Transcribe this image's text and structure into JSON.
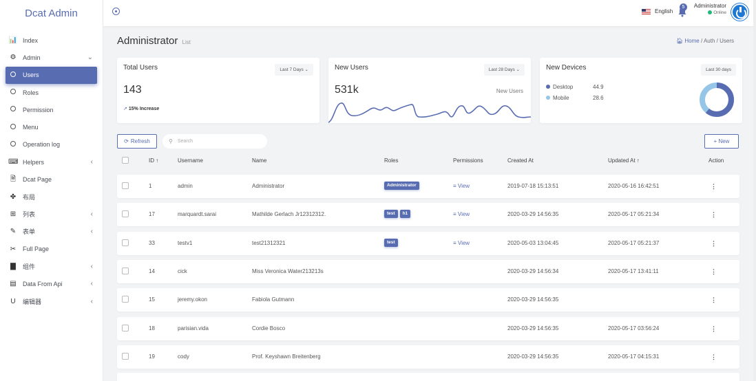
{
  "sidebar": {
    "brand": "Dcat Admin",
    "items": [
      {
        "label": "Index",
        "icon": "bar-chart-icon",
        "glyph": "📊"
      },
      {
        "label": "Admin",
        "icon": "gear-icon",
        "glyph": "⚙",
        "arrow": "⌄"
      },
      {
        "label": "Users",
        "icon": "circle-icon",
        "active": true
      },
      {
        "label": "Roles",
        "icon": "circle-icon"
      },
      {
        "label": "Permission",
        "icon": "circle-icon"
      },
      {
        "label": "Menu",
        "icon": "circle-icon"
      },
      {
        "label": "Operation log",
        "icon": "circle-icon"
      },
      {
        "label": "Helpers",
        "icon": "keyboard-icon",
        "glyph": "⌨",
        "arrow": "‹"
      },
      {
        "label": "Dcat Page",
        "icon": "document-icon",
        "glyph": "🗎"
      },
      {
        "label": "布局",
        "icon": "layout-icon",
        "glyph": "✤"
      },
      {
        "label": "列表",
        "icon": "grid-icon",
        "glyph": "⊞",
        "arrow": "‹"
      },
      {
        "label": "表单",
        "icon": "edit-icon",
        "glyph": "✎",
        "arrow": "‹"
      },
      {
        "label": "Full Page",
        "icon": "scissors-icon",
        "glyph": "✂"
      },
      {
        "label": "组件",
        "icon": "book-icon",
        "glyph": "▇",
        "arrow": "‹"
      },
      {
        "label": "Data From Api",
        "icon": "table-icon",
        "glyph": "▤",
        "arrow": "‹"
      },
      {
        "label": "编辑器",
        "icon": "underline-icon",
        "glyph": "U",
        "arrow": "‹"
      }
    ]
  },
  "topbar": {
    "language": "English",
    "notification_count": "5",
    "user_name": "Administrator",
    "user_status": "Online"
  },
  "page": {
    "title": "Administrator",
    "subtitle": "List",
    "breadcrumb": [
      "Home",
      "Auth",
      "Users"
    ]
  },
  "cards": {
    "total_users": {
      "title": "Total Users",
      "range": "Last 7 Days ⌄",
      "value": "143",
      "increase": "15% Increase"
    },
    "new_users": {
      "title": "New Users",
      "range": "Last 28 Days ⌄",
      "value": "531k",
      "sub": "New Users"
    },
    "new_devices": {
      "title": "New Devices",
      "range": "Last 30 days",
      "legend": [
        {
          "label": "Desktop",
          "value": "44.9",
          "color": "#586cb1"
        },
        {
          "label": "Mobile",
          "value": "28.6",
          "color": "#95c6e8"
        }
      ]
    }
  },
  "toolbar": {
    "refresh": "Refresh",
    "search_placeholder": "Search",
    "new": "+ New"
  },
  "table": {
    "headers": {
      "id": "ID ↑",
      "username": "Username",
      "name": "Name",
      "roles": "Roles",
      "permissions": "Permissions",
      "created": "Created At",
      "updated": "Updated At ↑",
      "action": "Action"
    },
    "rows": [
      {
        "id": "1",
        "username": "admin",
        "name": "Administrator",
        "roles": [
          "Administrator"
        ],
        "permissions": "≡ View",
        "created": "2019-07-18 15:13:51",
        "updated": "2020-05-16 16:42:51",
        "action": "⋮"
      },
      {
        "id": "17",
        "username": "marquardt.sarai",
        "name": "Mathilde Gerlach Jr12312312.",
        "roles": [
          "test",
          "h1"
        ],
        "permissions": "≡ View",
        "created": "2020-03-29 14:56:35",
        "updated": "2020-05-17 05:21:34",
        "action": "⋮"
      },
      {
        "id": "33",
        "username": "testv1",
        "name": "test21312321",
        "roles": [
          "test"
        ],
        "permissions": "≡ View",
        "created": "2020-05-03 13:04:45",
        "updated": "2020-05-17 05:21:37",
        "action": "⋮"
      },
      {
        "id": "14",
        "username": "cick",
        "name": "Miss Veronica Water213213s",
        "roles": [],
        "permissions": "",
        "created": "2020-03-29 14:56:34",
        "updated": "2020-05-17 13:41:11",
        "action": "⋮"
      },
      {
        "id": "15",
        "username": "jeremy.okon",
        "name": "Fabiola Gutmann",
        "roles": [],
        "permissions": "",
        "created": "2020-03-29 14:56:35",
        "updated": "",
        "action": "⋮"
      },
      {
        "id": "18",
        "username": "parisian.vida",
        "name": "Cordie Bosco",
        "roles": [],
        "permissions": "",
        "created": "2020-03-29 14:56:35",
        "updated": "2020-05-17 03:56:24",
        "action": "⋮"
      },
      {
        "id": "19",
        "username": "cody",
        "name": "Prof. Keyshawn Breitenberg",
        "roles": [],
        "permissions": "",
        "created": "2020-03-29 14:56:35",
        "updated": "2020-05-17 04:15:31",
        "action": "⋮"
      }
    ]
  },
  "colors": {
    "accent": "#586cb1",
    "online": "#21b978",
    "mobile": "#95c6e8"
  }
}
